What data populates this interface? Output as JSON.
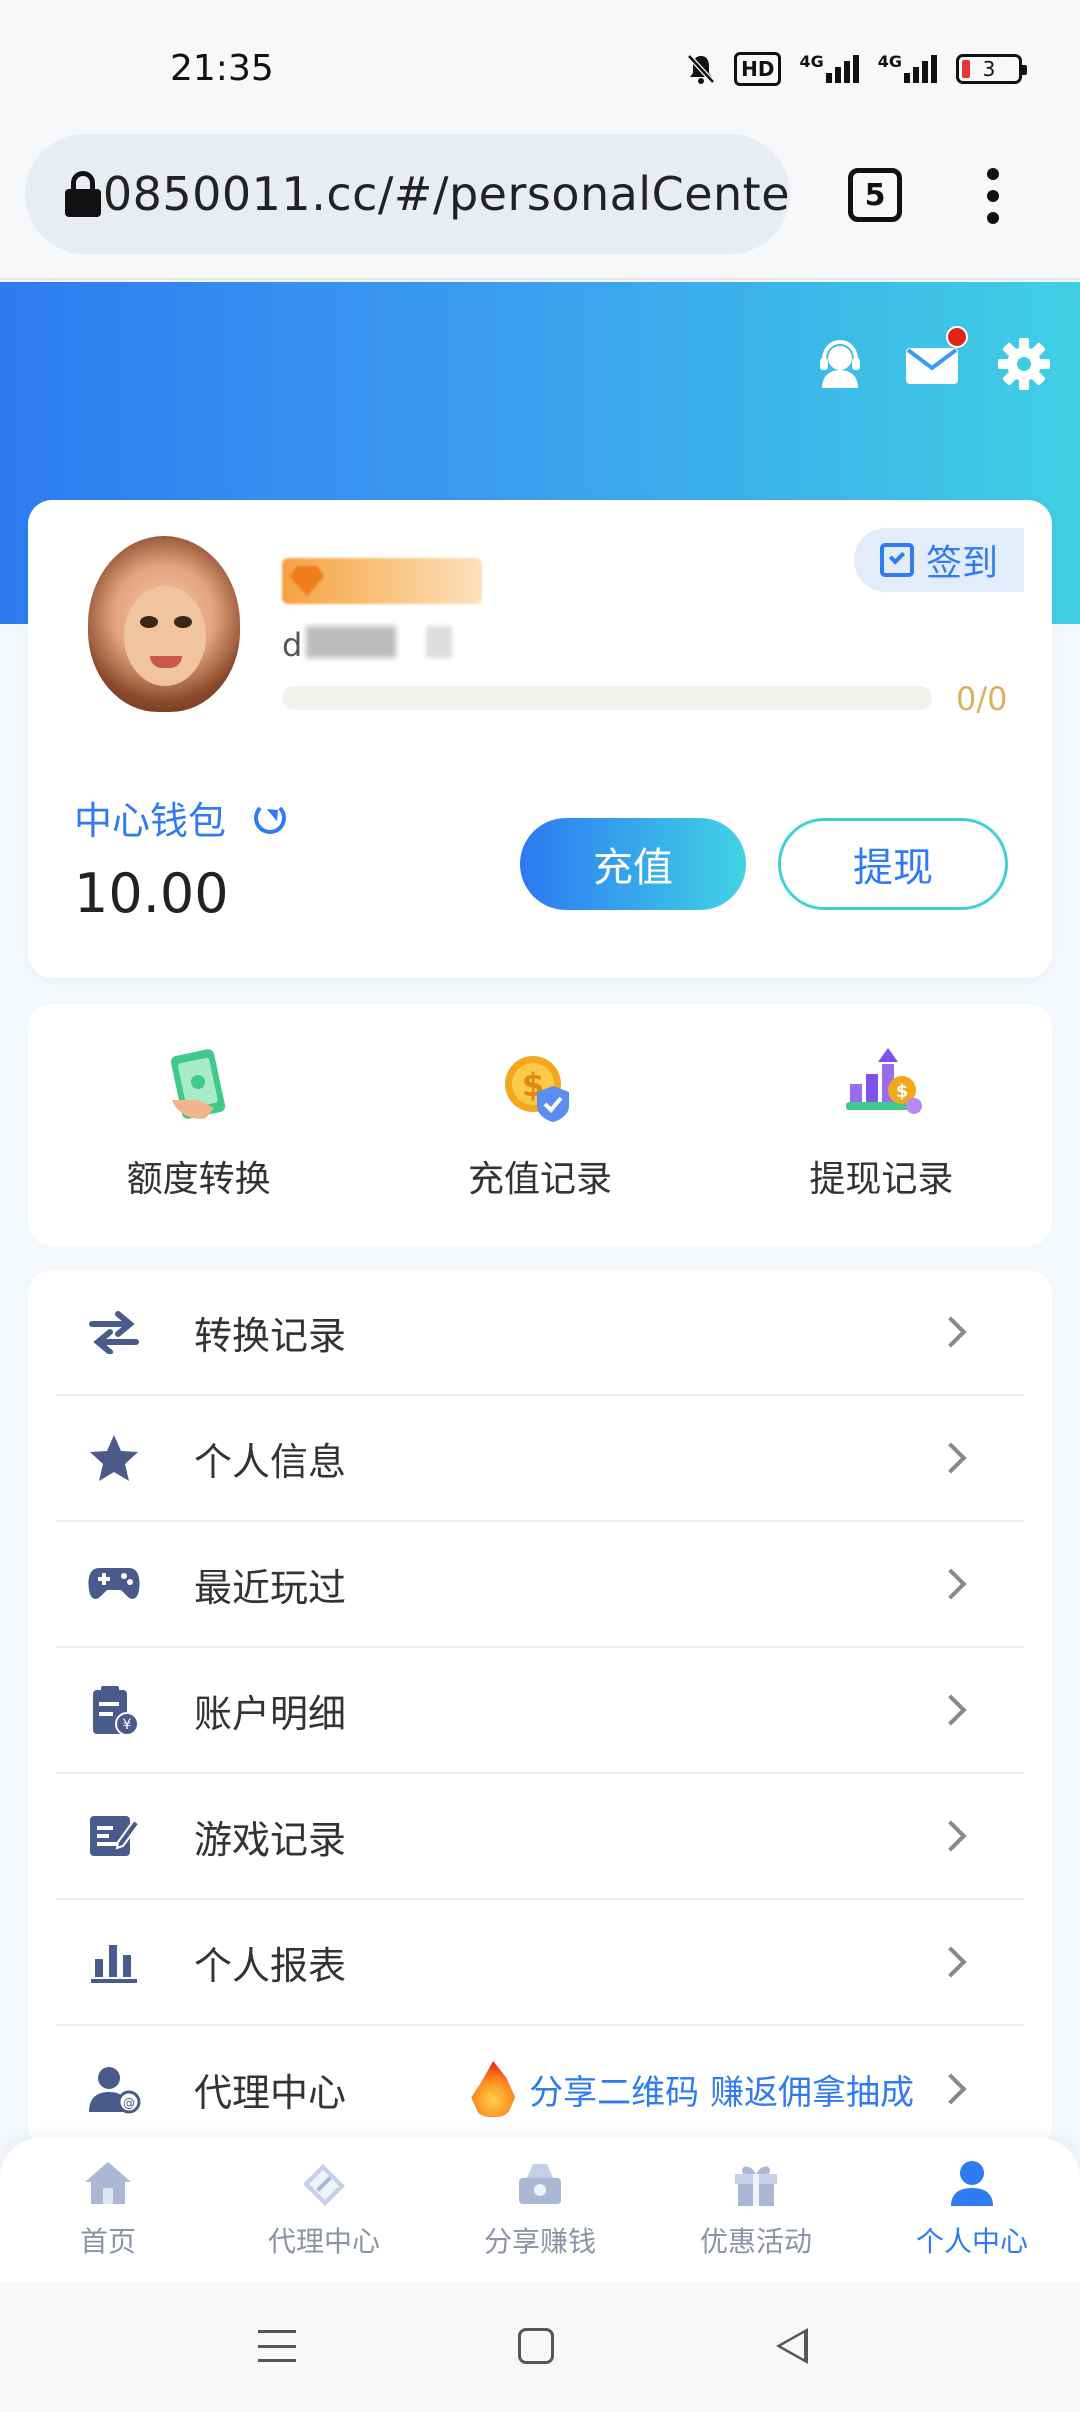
{
  "status_bar": {
    "time": "21:35",
    "hd_label": "HD",
    "network_1": "4G",
    "network_2": "4G",
    "battery": "3"
  },
  "browser": {
    "url": "0850011.cc/#/personalCente",
    "tab_count": "5"
  },
  "header": {
    "icons": [
      "customer-service-icon",
      "mail-icon",
      "settings-icon"
    ],
    "has_unread_mail": true
  },
  "profile": {
    "username_prefix": "d",
    "progress_text": "0/0",
    "progress": 0,
    "signin_label": "签到"
  },
  "wallet": {
    "label": "中心钱包",
    "balance": "10.00",
    "recharge_label": "充值",
    "withdraw_label": "提现"
  },
  "quick_actions": [
    {
      "label": "额度转换",
      "icon": "transfer-cash-icon"
    },
    {
      "label": "充值记录",
      "icon": "recharge-coin-icon"
    },
    {
      "label": "提现记录",
      "icon": "withdraw-growth-icon"
    }
  ],
  "menu": [
    {
      "label": "转换记录",
      "icon": "swap-arrows-icon"
    },
    {
      "label": "个人信息",
      "icon": "star-icon"
    },
    {
      "label": "最近玩过",
      "icon": "gamepad-icon"
    },
    {
      "label": "账户明细",
      "icon": "clipboard-yen-icon"
    },
    {
      "label": "游戏记录",
      "icon": "edit-note-icon"
    },
    {
      "label": "个人报表",
      "icon": "bar-chart-icon"
    },
    {
      "label": "代理中心",
      "icon": "agent-person-icon",
      "promo": "分享二维码 赚返佣拿抽成"
    }
  ],
  "bottom_nav": [
    {
      "label": "首页",
      "icon": "home-icon",
      "active": false
    },
    {
      "label": "代理中心",
      "icon": "agent-icon",
      "active": false
    },
    {
      "label": "分享赚钱",
      "icon": "share-money-icon",
      "active": false
    },
    {
      "label": "优惠活动",
      "icon": "gift-icon",
      "active": false
    },
    {
      "label": "个人中心",
      "icon": "user-icon",
      "active": true
    }
  ],
  "colors": {
    "primary": "#2f7bf1",
    "gradient_end": "#3fcfe4",
    "gold": "#d9b15f",
    "nav_inactive": "#8a94a6"
  }
}
